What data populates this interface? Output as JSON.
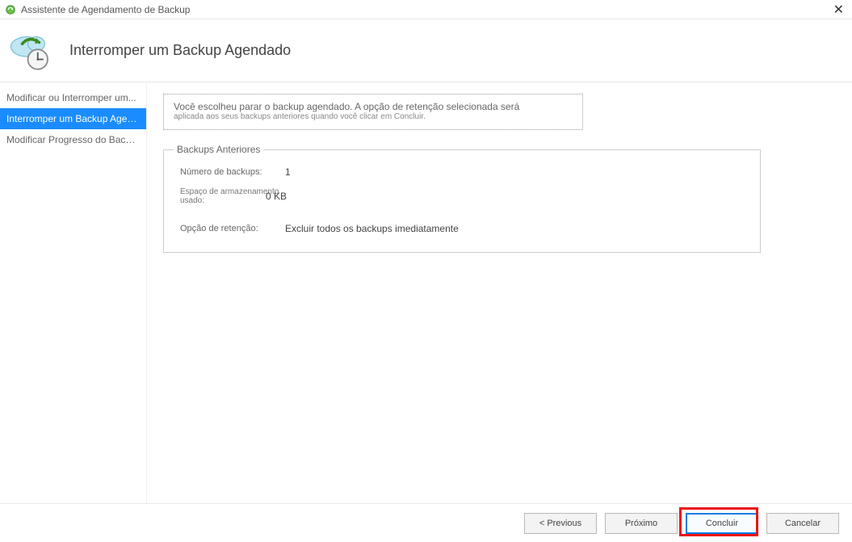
{
  "titlebar": {
    "title": "Assistente de Agendamento de Backup"
  },
  "header": {
    "page_title": "Interromper um Backup Agendado"
  },
  "sidebar": {
    "items": [
      {
        "label": "Modificar ou Interromper um..."
      },
      {
        "label": "Interromper um Backup Agendado"
      },
      {
        "label": "Modificar Progresso do Backup"
      }
    ]
  },
  "content": {
    "info_line1": "Você escolheu parar o backup agendado. A opção de retenção selecionada será",
    "info_line2": "aplicada aos seus backups anteriores quando você clicar em Concluir.",
    "fieldset_legend": "Backups Anteriores",
    "rows": {
      "num_backups_label": "Número de backups:",
      "num_backups_value": "1",
      "storage_label": "Espaço de armazenamento usado:",
      "storage_value": "0 KB",
      "retention_label": "Opção de retenção:",
      "retention_value": "Excluir todos os backups imediatamente"
    }
  },
  "footer": {
    "previous": "< Previous",
    "next": "Próximo",
    "finish": "Concluir",
    "cancel": "Cancelar"
  }
}
